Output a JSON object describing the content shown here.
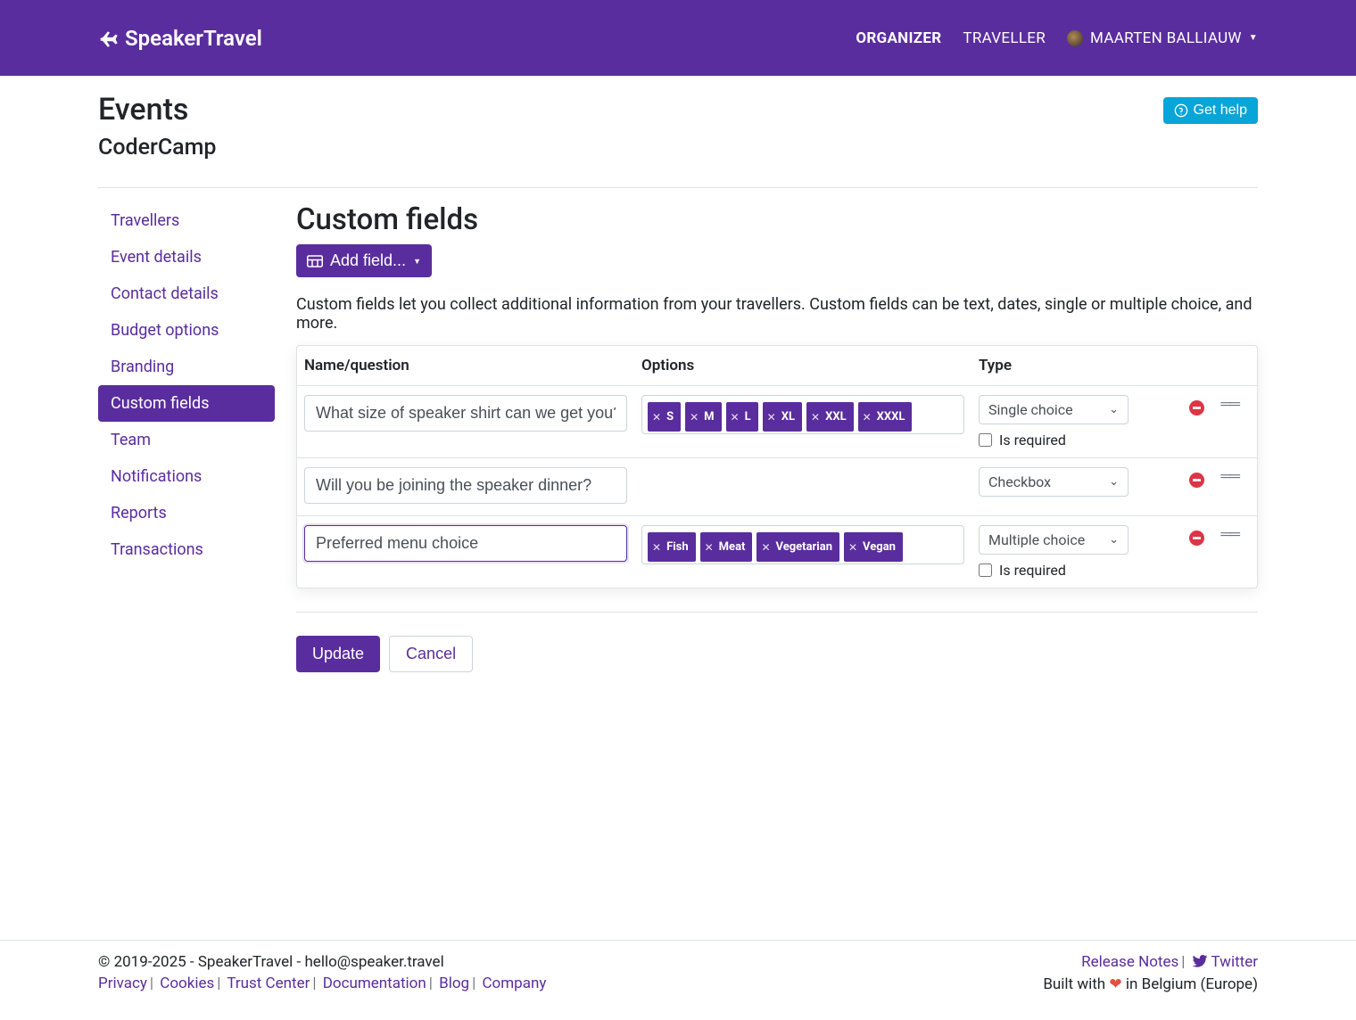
{
  "nav": {
    "logo": "SpeakerTravel",
    "links": {
      "organizer": "ORGANIZER",
      "traveller": "TRAVELLER"
    },
    "user_name": "MAARTEN BALLIAUW"
  },
  "header": {
    "title": "Events",
    "subtitle": "CoderCamp",
    "help_label": "Get help"
  },
  "sidebar": {
    "items": [
      {
        "label": "Travellers"
      },
      {
        "label": "Event details"
      },
      {
        "label": "Contact details"
      },
      {
        "label": "Budget options"
      },
      {
        "label": "Branding"
      },
      {
        "label": "Custom fields"
      },
      {
        "label": "Team"
      },
      {
        "label": "Notifications"
      },
      {
        "label": "Reports"
      },
      {
        "label": "Transactions"
      }
    ],
    "active_index": 5
  },
  "main": {
    "title": "Custom fields",
    "add_field_label": "Add field...",
    "description": "Custom fields let you collect additional information from your travellers. Custom fields can be text, dates, single or multiple choice, and more.",
    "columns": {
      "name": "Name/question",
      "options": "Options",
      "type": "Type"
    },
    "required_label": "Is required",
    "rows": [
      {
        "name": "What size of speaker shirt can we get you?",
        "options": [
          "S",
          "M",
          "L",
          "XL",
          "XXL",
          "XXXL"
        ],
        "type": "Single choice",
        "show_required": true
      },
      {
        "name": "Will you be joining the speaker dinner?",
        "options": [],
        "type": "Checkbox",
        "show_required": false
      },
      {
        "name": "Preferred menu choice",
        "options": [
          "Fish",
          "Meat",
          "Vegetarian",
          "Vegan"
        ],
        "type": "Multiple choice",
        "show_required": true,
        "focused": true
      }
    ],
    "update_label": "Update",
    "cancel_label": "Cancel"
  },
  "footer": {
    "copyright": "© 2019-2025 - SpeakerTravel - hello@speaker.travel",
    "links": {
      "privacy": "Privacy",
      "cookies": "Cookies",
      "trust": "Trust Center",
      "docs": "Documentation",
      "blog": "Blog",
      "company": "Company",
      "release": "Release Notes",
      "twitter": "Twitter"
    },
    "built_prefix": "Built with ",
    "built_suffix": " in Belgium (Europe)"
  }
}
